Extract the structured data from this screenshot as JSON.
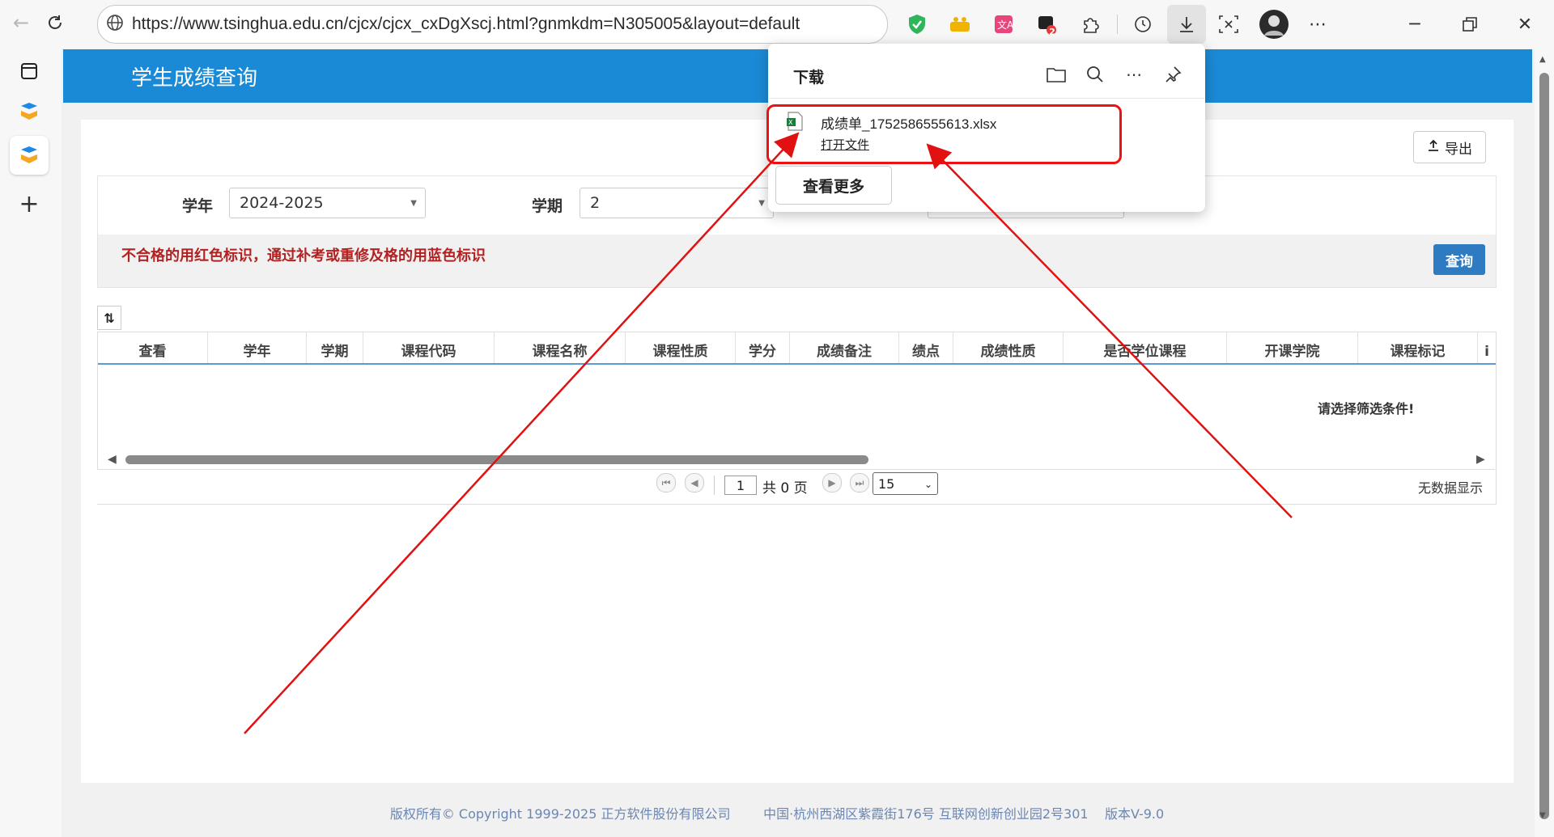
{
  "browser": {
    "url": "https://www.tsinghua.edu.cn/cjcx/cjcx_cxDgXscj.html?gnmkdm=N305005&layout=default",
    "extension_badge": "2"
  },
  "page": {
    "header_title": "学生成绩查询",
    "export_label": "导出",
    "filters": {
      "year_label": "学年",
      "year_value": "2024-2025",
      "term_label": "学期",
      "term_value": "2"
    },
    "notice": "不合格的用红色标识，通过补考或重修及格的用蓝色标识",
    "query_label": "查询",
    "table": {
      "columns": [
        "查看",
        "学年",
        "学期",
        "课程代码",
        "课程名称",
        "课程性质",
        "学分",
        "成绩备注",
        "绩点",
        "成绩性质",
        "是否学位课程",
        "开课学院",
        "课程标记",
        "i"
      ],
      "empty_message": "请选择筛选条件!"
    },
    "pager": {
      "page_value": "1",
      "total_text": "共 0 页",
      "page_size": "15",
      "no_data": "无数据显示"
    },
    "footer": {
      "copyright": "版权所有© Copyright 1999-2025 正方软件股份有限公司",
      "address": "中国·杭州西湖区紫霞街176号 互联网创新创业园2号301",
      "version": "版本V-9.0"
    }
  },
  "download_popup": {
    "title": "下载",
    "file_name": "成绩单_1752586555613.xlsx",
    "open_file": "打开文件",
    "see_more": "查看更多"
  },
  "colors": {
    "header_blue": "#1b8ad6",
    "query_blue": "#2f7bc1",
    "notice_red": "#b22222",
    "annotation_red": "#e11111"
  }
}
